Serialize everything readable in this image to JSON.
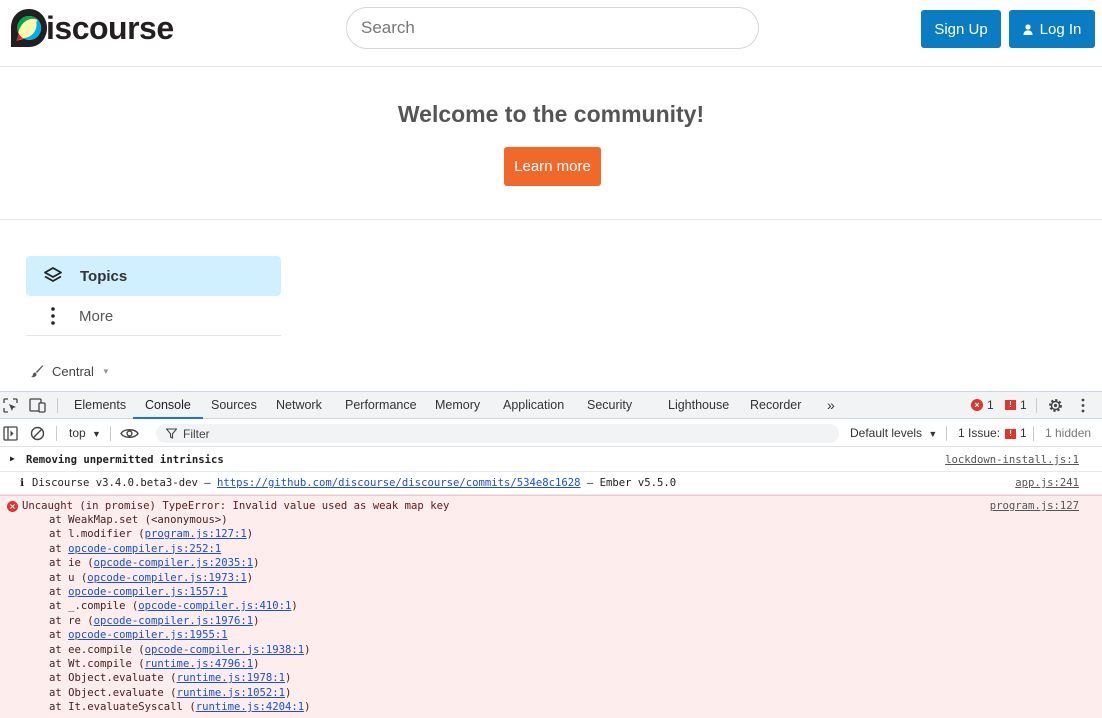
{
  "header": {
    "logo_text": "iscourse",
    "search_placeholder": "Search",
    "signup_label": "Sign Up",
    "login_label": "Log In"
  },
  "banner": {
    "title": "Welcome to the community!",
    "learn_more_label": "Learn more"
  },
  "sidebar": {
    "topics_label": "Topics",
    "more_label": "More",
    "category_label": "Central"
  },
  "devtools": {
    "tabs": [
      "Elements",
      "Console",
      "Sources",
      "Network",
      "Performance",
      "Memory",
      "Application",
      "Security",
      "Lighthouse",
      "Recorder"
    ],
    "error_count": "1",
    "warning_count": "1",
    "context_label": "top",
    "filter_placeholder": "Filter",
    "levels_label": "Default levels",
    "issues_label": "1 Issue:",
    "issues_count": "1",
    "hidden_label": "1 hidden"
  },
  "console": {
    "row1_msg": "Removing unpermitted intrinsics",
    "row1_src": "lockdown-install.js:1",
    "row2_prefix": "Discourse v3.4.0.beta3-dev — ",
    "row2_link": "https://github.com/discourse/discourse/commits/534e8c1628",
    "row2_suffix": " — Ember v5.5.0",
    "row2_src": "app.js:241",
    "error_msg": "Uncaught (in promise) TypeError: Invalid value used as weak map key",
    "error_src": "program.js:127",
    "stack": [
      {
        "pre": "at WeakMap.set (<anonymous>)",
        "link": "",
        "post": ""
      },
      {
        "pre": "at l.modifier (",
        "link": "program.js:127:1",
        "post": ")"
      },
      {
        "pre": "at ",
        "link": "opcode-compiler.js:252:1",
        "post": ""
      },
      {
        "pre": "at ie (",
        "link": "opcode-compiler.js:2035:1",
        "post": ")"
      },
      {
        "pre": "at u (",
        "link": "opcode-compiler.js:1973:1",
        "post": ")"
      },
      {
        "pre": "at ",
        "link": "opcode-compiler.js:1557:1",
        "post": ""
      },
      {
        "pre": "at _.compile (",
        "link": "opcode-compiler.js:410:1",
        "post": ")"
      },
      {
        "pre": "at re (",
        "link": "opcode-compiler.js:1976:1",
        "post": ")"
      },
      {
        "pre": "at ",
        "link": "opcode-compiler.js:1955:1",
        "post": ""
      },
      {
        "pre": "at ee.compile (",
        "link": "opcode-compiler.js:1938:1",
        "post": ")"
      },
      {
        "pre": "at Wt.compile (",
        "link": "runtime.js:4796:1",
        "post": ")"
      },
      {
        "pre": "at Object.evaluate (",
        "link": "runtime.js:1978:1",
        "post": ")"
      },
      {
        "pre": "at Object.evaluate (",
        "link": "runtime.js:1052:1",
        "post": ")"
      },
      {
        "pre": "at It.evaluateSyscall (",
        "link": "runtime.js:4204:1",
        "post": ")"
      }
    ]
  },
  "colors": {
    "accent_blue": "#0a7cc2",
    "learn_orange": "#f1692a",
    "topics_bg": "#d1f0ff",
    "error_red": "#dc362e",
    "error_row_bg": "#fdeded"
  }
}
